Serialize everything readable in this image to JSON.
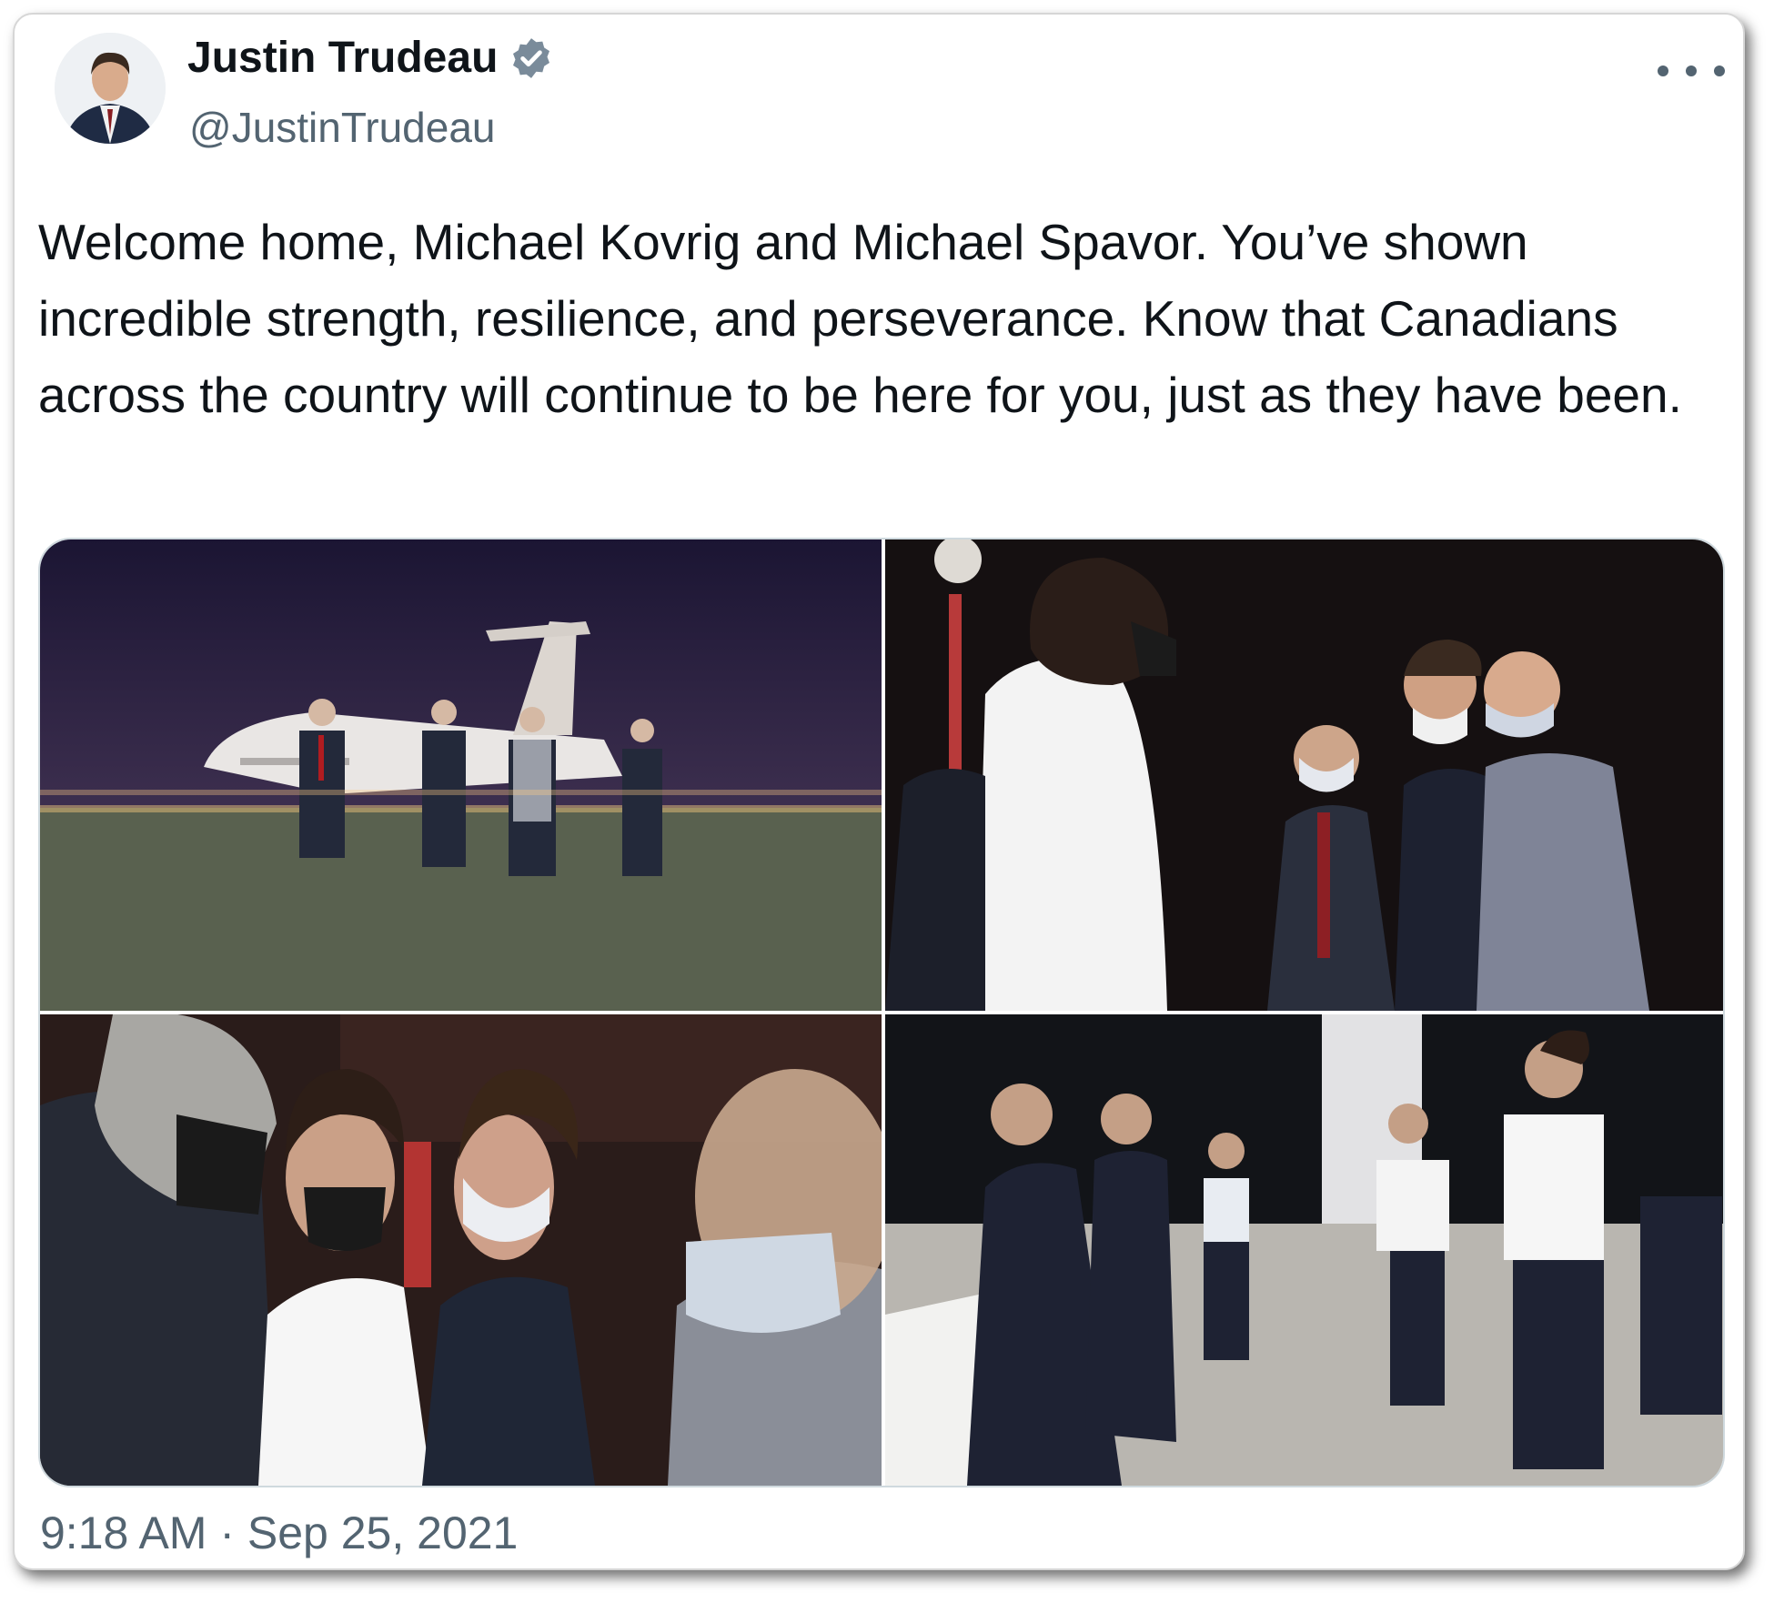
{
  "author": {
    "name": "Justin Trudeau",
    "handle": "@JustinTrudeau",
    "verified": true,
    "verified_badge_color": "#7a8b9a"
  },
  "tweet": {
    "text": "Welcome home, Michael Kovrig and Michael Spavor. You’ve shown incredible strength, resilience, and perseverance. Know that Canadians across the country will continue to be here for you, just as they have been.",
    "timestamp": "9:18 AM · Sep 25, 2021"
  },
  "media": [
    {
      "icon": "photo-airport-tarmac-night"
    },
    {
      "icon": "photo-group-talking-night"
    },
    {
      "icon": "photo-greeting-masks"
    },
    {
      "icon": "photo-hangar-reception"
    }
  ],
  "colors": {
    "text_primary": "#0f1419",
    "text_secondary": "#536471",
    "border": "#cfd9de"
  }
}
